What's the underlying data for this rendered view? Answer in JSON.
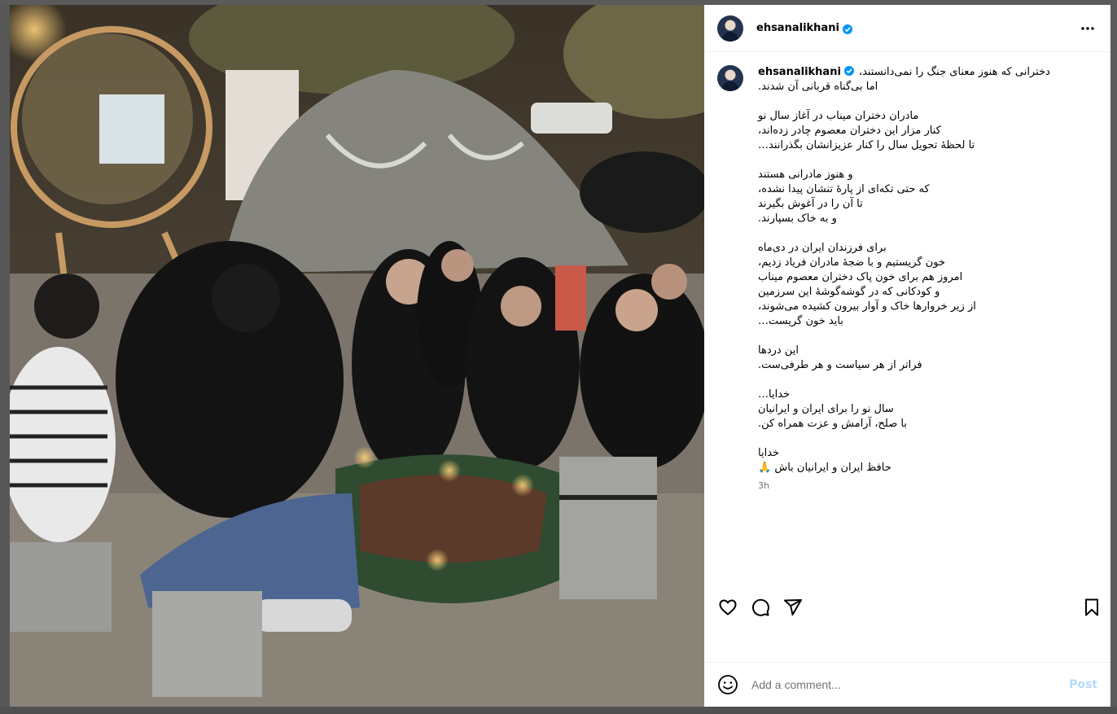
{
  "post": {
    "username": "ehsanalikhani",
    "verified": true,
    "caption_first_line": "دخترانی که هنوز معنای جنگ را نمی‌دانستند،",
    "caption_rest": "اما بی‌گناه قربانی آن شدند.\n\nمادران دختران میناب در آغاز سال نو\nکنار مزار این دختران معصوم چادر زده‌اند،\nتا لحظهٔ تحویل سال را کنار عزیزانشان بگذرانند…\n\nو هنوز مادرانی هستند\nکه حتی تکه‌ای از پارهٔ تنشان پیدا نشده،\nتا آن را در آغوش بگیرند\nو به خاک بسپارند.\n\nبرای فرزندان ایران در دی‌ماه\nخون گریستیم و با ضجهٔ مادران فریاد زدیم،\nامروز هم برای خون پاک دختران معصوم میناب\nو کودکانی که در گوشه‌گوشهٔ این سرزمین\nاز زیر خروارها خاک و آوار بیرون کشیده می‌شوند،\nباید خون گریست…\n\nاین دردها\nفراتر از هر سیاست و هر طرفی‌ست.\n\nخدایا…\nسال نو را برای ایران و ایرانیان\nبا صلح، آرامش و عزت همراه کن.\n\nخدایا\nحافظ ایران و ایرانیان باش 🙏",
    "timestamp": "3h"
  },
  "comment_box": {
    "placeholder": "Add a comment...",
    "post_label": "Post"
  },
  "icons": {
    "header": "more-horizontal-icon",
    "actions": [
      "heart-icon",
      "comment-icon",
      "share-icon",
      "bookmark-icon"
    ],
    "emoji": "emoji-icon"
  },
  "colors": {
    "verified": "#0095f6",
    "post_button_disabled": "#b3dbff",
    "muted_text": "#737373"
  }
}
